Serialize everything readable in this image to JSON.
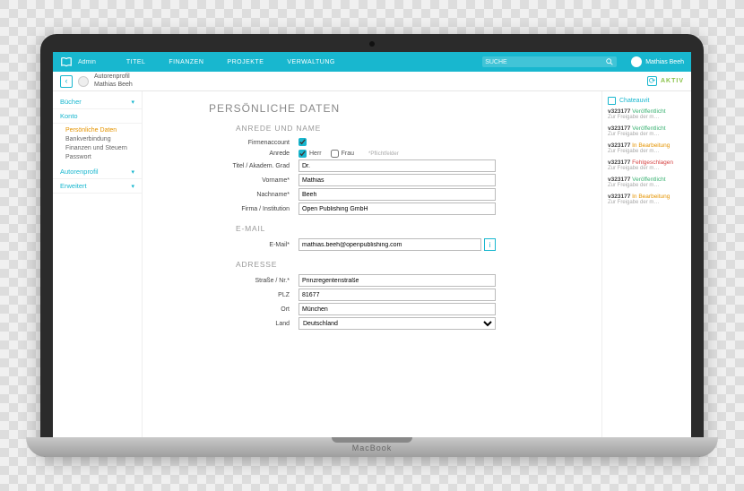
{
  "brand": "Admin",
  "nav": {
    "items": [
      "TITEL",
      "FINANZEN",
      "PROJEKTE",
      "VERWALTUNG"
    ]
  },
  "search": {
    "placeholder": "SUCHE"
  },
  "user": {
    "name": "Mathias Beeh"
  },
  "breadcrumb": {
    "line1": "Autorenprofil",
    "line2": "Mathias Beeh"
  },
  "status": "AKTIV",
  "sidebar": {
    "sections": [
      {
        "label": "Bücher"
      },
      {
        "label": "Konto",
        "items": [
          "Persönliche Daten",
          "Bankverbindung",
          "Finanzen und Steuern",
          "Passwort"
        ]
      },
      {
        "label": "Autorenprofil"
      },
      {
        "label": "Erweitert"
      }
    ]
  },
  "page": {
    "title": "PERSÖNLICHE DATEN",
    "sec1": "ANREDE UND NAME",
    "sec2": "E-MAIL",
    "sec3": "ADRESSE",
    "labels": {
      "firmenaccount": "Firmenaccount",
      "anrede": "Anrede",
      "herr": "Herr",
      "frau": "Frau",
      "titel": "Titel / Akadem. Grad",
      "vorname": "Vorname",
      "nachname": "Nachname",
      "firma": "Firma / Institution",
      "email": "E-Mail",
      "strasse": "Straße / Nr.",
      "plz": "PLZ",
      "ort": "Ort",
      "land": "Land",
      "pflicht": "*Pflichtfelder"
    },
    "values": {
      "titel": "Dr.",
      "vorname": "Mathias",
      "nachname": "Beeh",
      "firma": "Open Publishing GmbH",
      "email": "mathias.beeh@openpublishing.com",
      "strasse": "Prinzregentenstraße",
      "plz": "81677",
      "ort": "München",
      "land": "Deutschland"
    }
  },
  "activity": {
    "title": "Chateauvit",
    "items": [
      {
        "id": "v323177",
        "status": "Veröffentlicht",
        "cls": "st-green",
        "sub": "Zur Freigabe der m…"
      },
      {
        "id": "v323177",
        "status": "Veröffentlicht",
        "cls": "st-green",
        "sub": "Zur Freigabe der m…"
      },
      {
        "id": "v323177",
        "status": "In Bearbeitung",
        "cls": "st-orange",
        "sub": "Zur Freigabe der m…"
      },
      {
        "id": "v323177",
        "status": "Fehlgeschlagen",
        "cls": "st-red",
        "sub": "Zur Freigabe der m…"
      },
      {
        "id": "v323177",
        "status": "Veröffentlicht",
        "cls": "st-green",
        "sub": "Zur Freigabe der m…"
      },
      {
        "id": "v323177",
        "status": "In Bearbeitung",
        "cls": "st-orange",
        "sub": "Zur Freigabe der m…"
      }
    ]
  }
}
